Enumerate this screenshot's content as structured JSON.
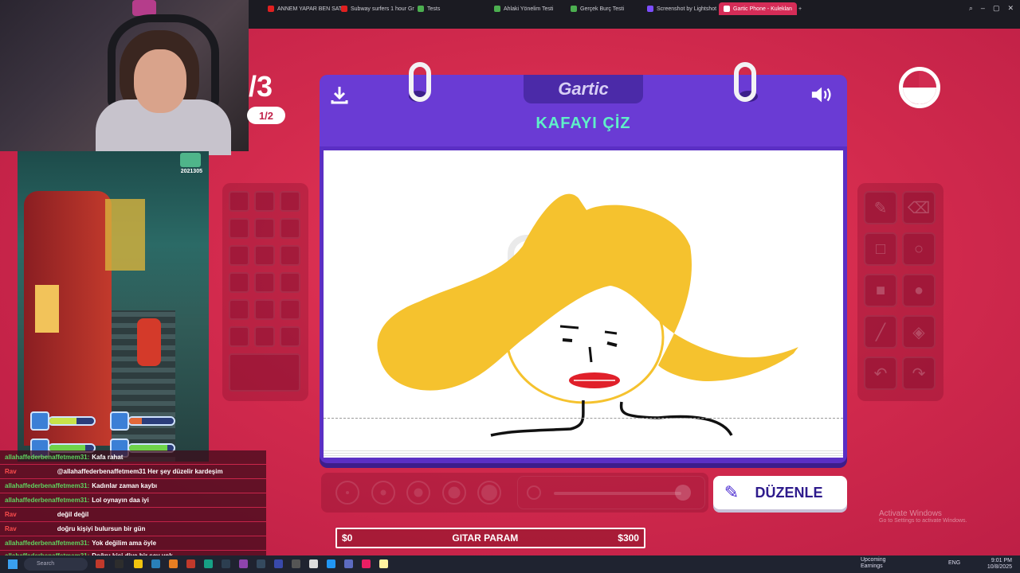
{
  "browser": {
    "tabs": [
      {
        "label": "ANNEM YAPAR BEN SAT",
        "color": "#e02020"
      },
      {
        "label": "Subway surfers 1 hour Gr",
        "color": "#e02020"
      },
      {
        "label": "Tests",
        "color": "#4caf50"
      },
      {
        "label": "Ahlaki Yönelim Testi",
        "color": "#4caf50"
      },
      {
        "label": "Gerçek Burç Testi",
        "color": "#4caf50"
      },
      {
        "label": "Screenshot by Lightshot",
        "color": "#7c4dff"
      },
      {
        "label": "Gartic Phone - Kuleklan",
        "color": "#d52c57",
        "active": true
      }
    ],
    "new_tab": "+"
  },
  "game_overlay": {
    "score": "2021305"
  },
  "round": {
    "counter": "/3",
    "sub": "1/2"
  },
  "card": {
    "brand": "Gartic",
    "prompt": "KAFAYI ÇİZ",
    "download_icon": "download-icon",
    "sound_icon": "speaker-icon"
  },
  "edit_button": {
    "label": "DÜZENLE",
    "icon": "pencil-icon"
  },
  "donation": {
    "left": "$0",
    "title": "GITAR PARAM",
    "right": "$300"
  },
  "activate": {
    "title": "Activate Windows",
    "sub": "Go to Settings to activate Windows."
  },
  "chat": [
    {
      "user": "allahaffederbenaffetmem31:",
      "text": "Kafa rahat",
      "color": "#5fd35f"
    },
    {
      "user": "Rav",
      "text": "@allahaffederbenaffetmem31 Her şey düzelir kardeşim",
      "color": "#ff4d4d"
    },
    {
      "user": "allahaffederbenaffetmem31:",
      "text": "Kadınlar zaman kaybı",
      "color": "#5fd35f"
    },
    {
      "user": "allahaffederbenaffetmem31:",
      "text": "Lol oynayın daa iyi",
      "color": "#5fd35f"
    },
    {
      "user": "Rav",
      "text": "değil değil",
      "color": "#ff4d4d"
    },
    {
      "user": "Rav",
      "text": "doğru kişiyi bulursun bir gün",
      "color": "#ff4d4d"
    },
    {
      "user": "allahaffederbenaffetmem31:",
      "text": "Yok değilim ama öyle",
      "color": "#5fd35f"
    },
    {
      "user": "allahaffederbenaffetmem31:",
      "text": "Doğru kişi diye bir şey yok",
      "color": "#5fd35f"
    }
  ],
  "taskbar": {
    "search": "Search",
    "tray_label": "Upcoming",
    "tray_sub": "Earnings",
    "lang": "ENG",
    "time": "9:01 PM",
    "date": "10/8/2025"
  },
  "colors": {
    "accent": "#d52c57",
    "card": "#5b2fc4",
    "prompt": "#5ff0c8",
    "hair": "#f5c22e",
    "lips": "#e0202a"
  }
}
